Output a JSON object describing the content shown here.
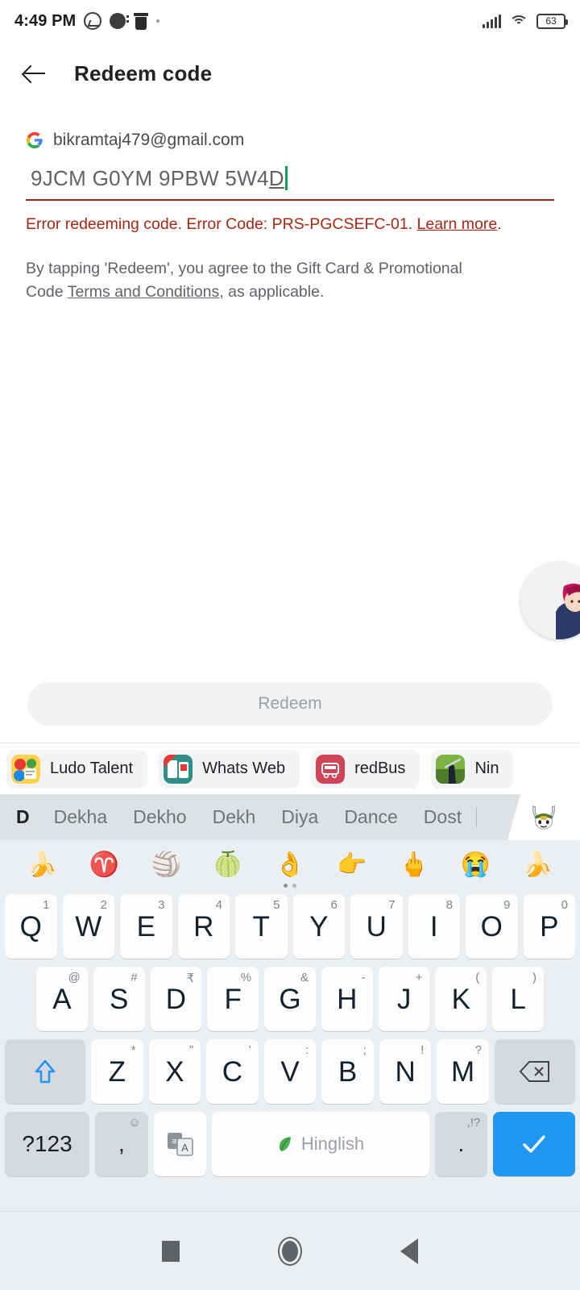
{
  "status_bar": {
    "time": "4:49 PM",
    "icons_left": [
      "messenger-icon",
      "notification-icon",
      "trash-icon",
      "dot-icon"
    ],
    "icons_right": [
      "signal-icon",
      "wifi-icon",
      "battery-icon"
    ],
    "battery_level": "63"
  },
  "app_bar": {
    "back_icon": "back-arrow-icon",
    "title": "Redeem code"
  },
  "account": {
    "provider_icon": "google-g-icon",
    "email": "bikramtaj479@gmail.com"
  },
  "code_field": {
    "value_prefix": "9JCM G0YM 9PBW 5W4",
    "value_composing": "D",
    "full_value": "9JCM G0YM 9PBW 5W4D",
    "underline_color": "#a52714",
    "caret_color": "#0f9d58"
  },
  "error": {
    "message": "Error redeeming code. Error Code: PRS-PGCSEFC-01. ",
    "link": "Learn more",
    "suffix": ".",
    "color": "#a52714"
  },
  "terms": {
    "line1": "By tapping 'Redeem', you agree to the Gift Card & Promotional",
    "line2_prefix": "Code ",
    "link": "Terms and Conditions",
    "line2_suffix": ", as applicable."
  },
  "redeem_button": {
    "label": "Redeem",
    "enabled": false,
    "bg": "#f1f3f4",
    "text_color": "#9aa0a6"
  },
  "chat_head": {
    "name": "floating-chat-head-avatar"
  },
  "app_chips": [
    {
      "label": "Ludo Talent",
      "icon": "ludo-talent-app-icon"
    },
    {
      "label": "Whats Web",
      "icon": "whats-web-app-icon"
    },
    {
      "label": "redBus",
      "icon": "redbus-app-icon"
    },
    {
      "label": "Nin",
      "icon": "ninja-game-app-icon"
    }
  ],
  "keyboard": {
    "suggestions": [
      "D",
      "Dekha",
      "Dekho",
      "Dekh",
      "Diya",
      "Dance",
      "Dost"
    ],
    "sticker_icon": "mi-bunny-sticker-icon",
    "emoji_row": [
      "🍌",
      "♈",
      "🏐",
      "🍈",
      "👌",
      "👉",
      "🖕",
      "😭",
      "🍌"
    ],
    "page_dots": 2,
    "row1": [
      {
        "key": "Q",
        "sup": "1"
      },
      {
        "key": "W",
        "sup": "2"
      },
      {
        "key": "E",
        "sup": "3"
      },
      {
        "key": "R",
        "sup": "4"
      },
      {
        "key": "T",
        "sup": "5"
      },
      {
        "key": "Y",
        "sup": "6"
      },
      {
        "key": "U",
        "sup": "7"
      },
      {
        "key": "I",
        "sup": "8"
      },
      {
        "key": "O",
        "sup": "9"
      },
      {
        "key": "P",
        "sup": "0"
      }
    ],
    "row2": [
      {
        "key": "A",
        "sup": "@"
      },
      {
        "key": "S",
        "sup": "#"
      },
      {
        "key": "D",
        "sup": "₹"
      },
      {
        "key": "F",
        "sup": "%"
      },
      {
        "key": "G",
        "sup": "&"
      },
      {
        "key": "H",
        "sup": "-"
      },
      {
        "key": "J",
        "sup": "+"
      },
      {
        "key": "K",
        "sup": "("
      },
      {
        "key": "L",
        "sup": ")"
      }
    ],
    "row3": [
      {
        "key": "Z",
        "sup": "*"
      },
      {
        "key": "X",
        "sup": "\""
      },
      {
        "key": "C",
        "sup": "'"
      },
      {
        "key": "V",
        "sup": ":"
      },
      {
        "key": "B",
        "sup": ";"
      },
      {
        "key": "N",
        "sup": "!"
      },
      {
        "key": "M",
        "sup": "?"
      }
    ],
    "shift_key": "shift-key-icon",
    "backspace_key": "backspace-key-icon",
    "symbols_key": "?123",
    "comma_key": ",",
    "comma_sup": "☺",
    "language_key": "language-switch-icon",
    "space_label": "Hinglish",
    "space_icon": "leaf-icon",
    "period_key": ".",
    "period_sup": ",!?",
    "enter_key": "checkmark-icon",
    "enter_bg": "#1f97f3"
  },
  "nav_bar": {
    "recents": "recents-square-icon",
    "home": "home-circle-icon",
    "back": "back-triangle-icon"
  }
}
